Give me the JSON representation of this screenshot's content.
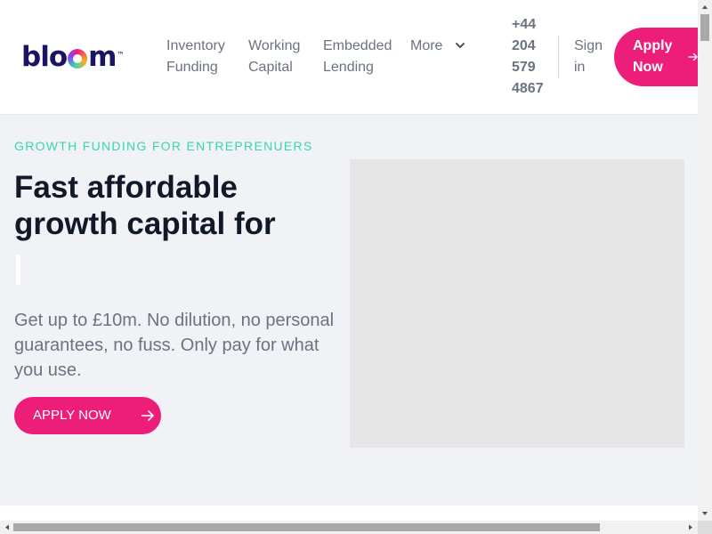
{
  "brand": {
    "logo_parts": [
      "blo",
      "m"
    ],
    "logo_tm": "™",
    "colors": {
      "pink": "#ec1e79",
      "teal": "#36d6b0",
      "navy": "#1b1464"
    }
  },
  "nav": {
    "items": [
      {
        "lines": [
          "Inventory",
          "Funding"
        ]
      },
      {
        "lines": [
          "Working",
          "Capital"
        ]
      },
      {
        "lines": [
          "Embedded",
          "Lending"
        ]
      },
      {
        "lines": [
          "More"
        ]
      }
    ],
    "phone_lines": [
      "+44",
      "204",
      "579",
      "4867"
    ],
    "signin_lines": [
      "Sign",
      "in"
    ],
    "apply_lines": [
      "Apply",
      "Now"
    ]
  },
  "hero": {
    "eyebrow": "GROWTH FUNDING FOR ENTREPRENUERS",
    "headline": "Fast affordable growth capital for",
    "lead": "Get up to £10m. No dilution, no personal guarantees, no fuss. Only pay for what you use.",
    "cta": "APPLY NOW"
  },
  "icons": {
    "chevron": "chevron-down-icon",
    "arrow": "arrow-right-icon"
  }
}
